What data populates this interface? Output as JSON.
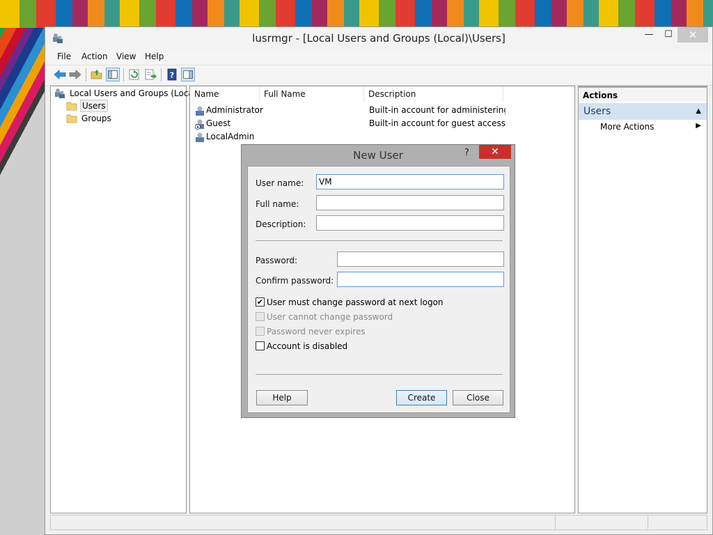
{
  "window": {
    "title": "lusrmgr - [Local Users and Groups (Local)\\Users]",
    "minimize_glyph": "—",
    "maximize_glyph": "☐",
    "close_glyph": "✕"
  },
  "menu": {
    "file": "File",
    "action": "Action",
    "view": "View",
    "help": "Help"
  },
  "toolbar": {
    "icons": [
      "back-arrow-icon",
      "forward-arrow-icon",
      "up-folder-icon",
      "show-hide-console-tree-icon",
      "refresh-icon",
      "export-list-icon",
      "help-icon",
      "show-hide-action-pane-icon"
    ]
  },
  "tree": {
    "root": "Local Users and Groups (Local)",
    "users": "Users",
    "groups": "Groups"
  },
  "list": {
    "columns": {
      "name": "Name",
      "full_name": "Full Name",
      "description": "Description"
    },
    "rows": [
      {
        "name": "Administrator",
        "full_name": "",
        "description": "Built-in account for administering..."
      },
      {
        "name": "Guest",
        "full_name": "",
        "description": "Built-in account for guest access t..."
      },
      {
        "name": "LocalAdmin",
        "full_name": "",
        "description": ""
      }
    ]
  },
  "actions": {
    "header": "Actions",
    "section": "Users",
    "more_actions": "More Actions",
    "collapse_glyph": "▲",
    "more_arrow_glyph": "▶"
  },
  "dialog": {
    "title": "New User",
    "help_glyph": "?",
    "close_glyph": "✕",
    "user_name_label": "User name:",
    "user_name_value": "VM",
    "full_name_label": "Full name:",
    "full_name_value": "",
    "description_label": "Description:",
    "description_value": "",
    "password_label": "Password:",
    "confirm_password_label": "Confirm password:",
    "checkboxes": {
      "must_change": {
        "label": "User must change password at next logon",
        "checked": true,
        "enabled": true
      },
      "cannot_change": {
        "label": "User cannot change password",
        "checked": false,
        "enabled": false
      },
      "never_expires": {
        "label": "Password never expires",
        "checked": false,
        "enabled": false
      },
      "disabled": {
        "label": "Account is disabled",
        "checked": false,
        "enabled": true
      }
    },
    "checkmark_glyph": "✔",
    "help_button": "Help",
    "create_button": "Create",
    "close_button": "Close"
  },
  "colors": {
    "selection_blue": "#cfe4f7",
    "actions_section_bg": "#d4e3f1",
    "dialog_close_red": "#c9302c",
    "focus_border": "#5e9ad6"
  }
}
